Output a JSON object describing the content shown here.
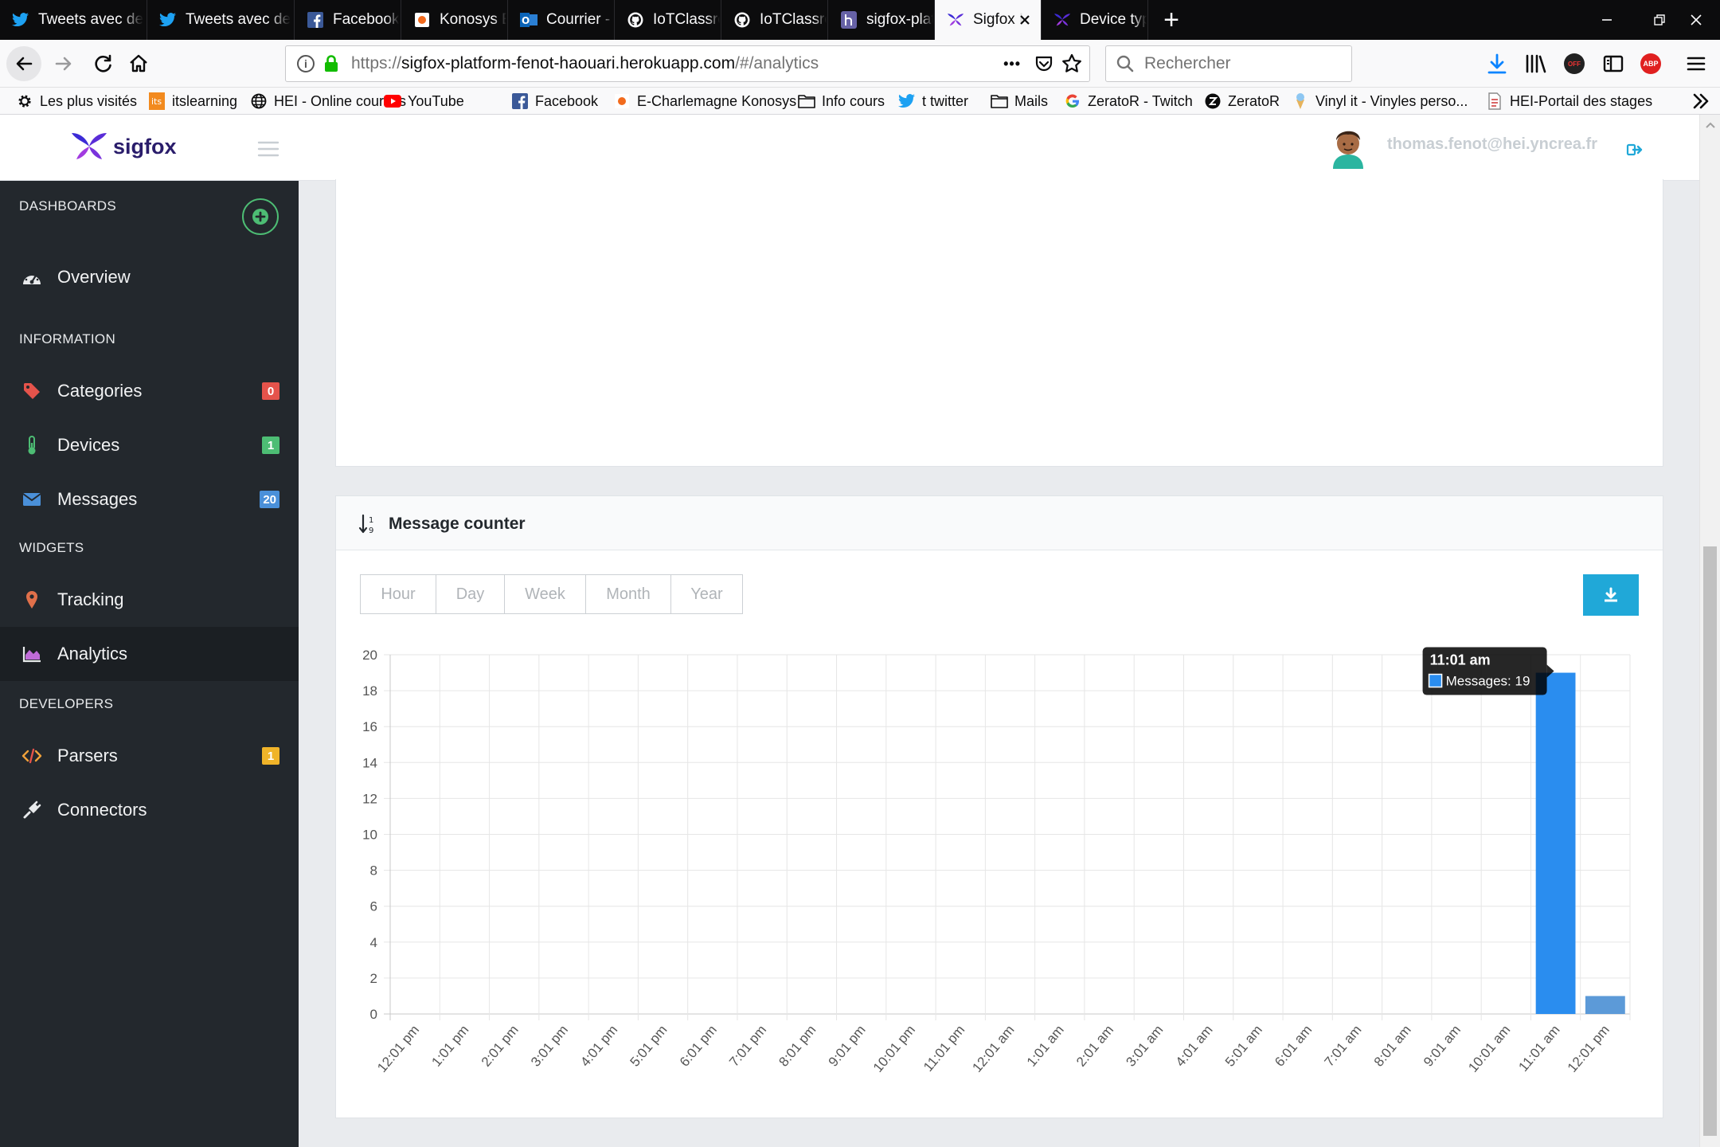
{
  "browser": {
    "tabs": [
      {
        "label": "Tweets avec de",
        "icon": "twitter-icon"
      },
      {
        "label": "Tweets avec de",
        "icon": "twitter-icon"
      },
      {
        "label": "Facebook",
        "icon": "facebook-icon"
      },
      {
        "label": "Konosys Educat",
        "icon": "konosys-icon"
      },
      {
        "label": "Courrier - thom",
        "icon": "outlook-icon"
      },
      {
        "label": "IoTClassroom/I",
        "icon": "github-icon"
      },
      {
        "label": "IoTClassroom/I",
        "icon": "github-icon"
      },
      {
        "label": "sigfox-platform",
        "icon": "heroku-icon"
      },
      {
        "label": "Sigfox Platfo",
        "icon": "sigfox-icon",
        "active": true
      },
      {
        "label": "Device type 'BK",
        "icon": "sigfox-icon"
      }
    ],
    "new_tab": "+",
    "url_prefix": "https://",
    "url_domain": "sigfox-platform-fenot-haouari.herokuapp.com",
    "url_path": "/#/analytics",
    "search_placeholder": "Rechercher",
    "more": "•••",
    "bookmarks": [
      {
        "label": "Les plus visités",
        "icon": "gear-icon"
      },
      {
        "label": "itslearning",
        "icon": "itslearning-icon"
      },
      {
        "label": "HEI - Online courses",
        "icon": "globe-icon"
      },
      {
        "label": "YouTube",
        "icon": "youtube-icon"
      },
      {
        "label": "Facebook",
        "icon": "facebook-icon"
      },
      {
        "label": "E-Charlemagne Konosys",
        "icon": "konosys-icon"
      },
      {
        "label": "Info cours",
        "icon": "folder-icon"
      },
      {
        "label": "t  twitter",
        "icon": "twitter-icon"
      },
      {
        "label": "Mails",
        "icon": "folder-icon"
      },
      {
        "label": "ZeratoR - Twitch",
        "icon": "google-icon"
      },
      {
        "label": "ZeratoR",
        "icon": "zeratorr-icon"
      },
      {
        "label": "Vinyl it - Vinyles perso...",
        "icon": "vinyl-icon"
      },
      {
        "label": "HEI-Portail des stages",
        "icon": "document-icon"
      }
    ],
    "abp": "ABP",
    "off": "OFF"
  },
  "app": {
    "brand": "sigfox",
    "user_email": "thomas.fenot@hei.yncrea.fr"
  },
  "sidebar": {
    "sections": {
      "dashboards": "DASHBOARDS",
      "information": "INFORMATION",
      "widgets": "WIDGETS",
      "developers": "DEVELOPERS"
    },
    "items": {
      "overview": {
        "label": "Overview"
      },
      "categories": {
        "label": "Categories",
        "badge": "0"
      },
      "devices": {
        "label": "Devices",
        "badge": "1"
      },
      "messages": {
        "label": "Messages",
        "badge": "20"
      },
      "tracking": {
        "label": "Tracking"
      },
      "analytics": {
        "label": "Analytics",
        "active": true
      },
      "parsers": {
        "label": "Parsers",
        "badge": "1"
      },
      "connectors": {
        "label": "Connectors"
      }
    }
  },
  "panel": {
    "title": "Message counter",
    "ranges": [
      "Hour",
      "Day",
      "Week",
      "Month",
      "Year"
    ]
  },
  "colors": {
    "sidebar_bg": "#23282d",
    "bar_fill": "#2a8def",
    "legend_swatch": "#5c9ad8",
    "download_btn": "#20a8d8",
    "badge_red": "#e5534b",
    "badge_green": "#4dbd74",
    "badge_blue": "#4a90d9",
    "badge_yellow": "#f0b429"
  },
  "chart_data": {
    "type": "bar",
    "title": "",
    "xlabel": "",
    "ylabel": "",
    "ylim": [
      0,
      20
    ],
    "yticks": [
      0,
      2,
      4,
      6,
      8,
      10,
      12,
      14,
      16,
      18,
      20
    ],
    "categories": [
      "12:01 pm",
      "1:01 pm",
      "2:01 pm",
      "3:01 pm",
      "4:01 pm",
      "5:01 pm",
      "6:01 pm",
      "7:01 pm",
      "8:01 pm",
      "9:01 pm",
      "10:01 pm",
      "11:01 pm",
      "12:01 am",
      "1:01 am",
      "2:01 am",
      "3:01 am",
      "4:01 am",
      "5:01 am",
      "6:01 am",
      "7:01 am",
      "8:01 am",
      "9:01 am",
      "10:01 am",
      "11:01 am",
      "12:01 pm"
    ],
    "series": [
      {
        "name": "Messages",
        "values": [
          0,
          0,
          0,
          0,
          0,
          0,
          0,
          0,
          0,
          0,
          0,
          0,
          0,
          0,
          0,
          0,
          0,
          0,
          0,
          0,
          0,
          0,
          0,
          19,
          1
        ]
      }
    ],
    "legend": "top-center",
    "grid": true,
    "tooltip": {
      "title": "11:01 am",
      "label": "Messages: 19"
    }
  }
}
